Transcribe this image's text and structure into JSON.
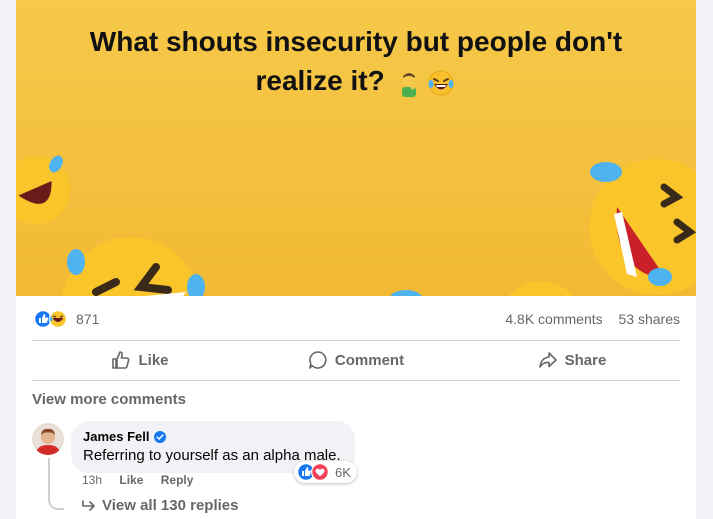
{
  "post": {
    "title": "What shouts insecurity but people don't realize it?",
    "title_emojis": [
      "facepalm-emoji",
      "laughing-tears-emoji"
    ]
  },
  "stats": {
    "reaction_count": "871",
    "comments": "4.8K comments",
    "shares": "53 shares"
  },
  "actions": {
    "like": "Like",
    "comment": "Comment",
    "share": "Share"
  },
  "comments_section": {
    "view_more": "View more comments",
    "comment": {
      "author": "James Fell",
      "verified": true,
      "text": "Referring to yourself as an alpha male.",
      "time": "13h",
      "like": "Like",
      "reply": "Reply",
      "reaction_count": "6K",
      "view_replies": "View all 130 replies"
    }
  },
  "colors": {
    "banner": "#f2b934",
    "facebook_blue": "#1877f2",
    "love_red": "#f33e58",
    "secondary_text": "#65676b"
  }
}
